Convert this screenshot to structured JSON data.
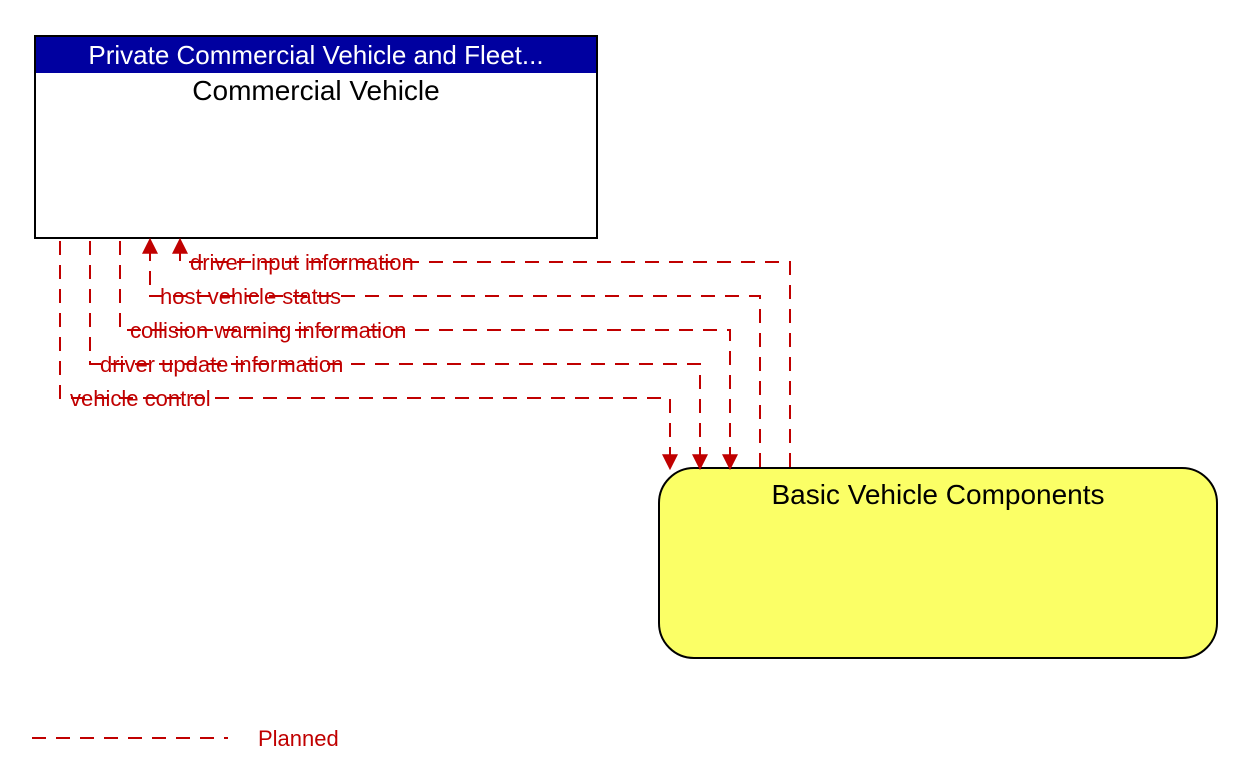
{
  "boxes": {
    "top": {
      "header": "Private Commercial Vehicle and Fleet...",
      "body": "Commercial Vehicle"
    },
    "bottom": {
      "title": "Basic Vehicle Components"
    }
  },
  "flows": [
    {
      "name": "driver input information"
    },
    {
      "name": "host vehicle status"
    },
    {
      "name": "collision warning information"
    },
    {
      "name": "driver update information"
    },
    {
      "name": "vehicle control"
    }
  ],
  "legend": {
    "label": "Planned"
  },
  "colors": {
    "flow": "#c00000",
    "header_bg": "#0000a0",
    "bottom_fill": "#fbff66"
  }
}
